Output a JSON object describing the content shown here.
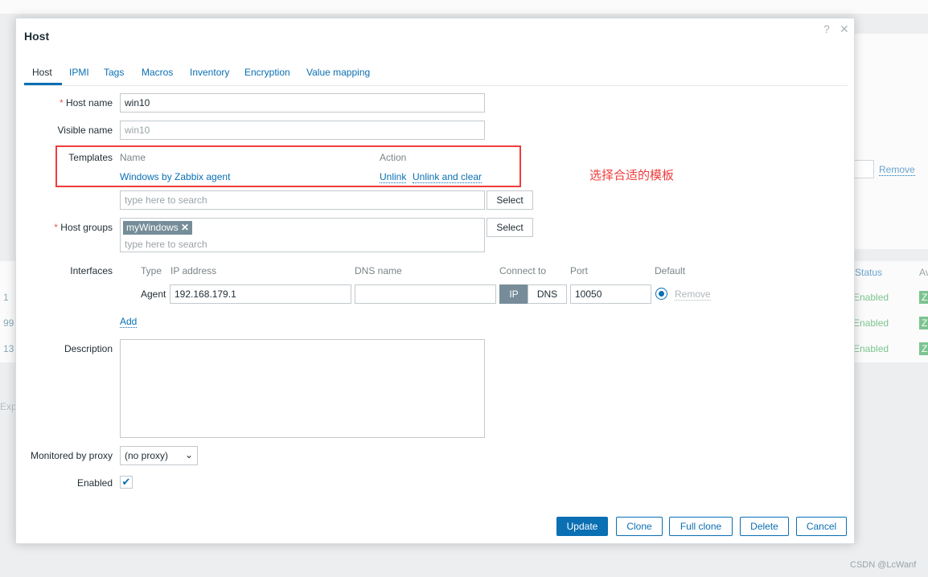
{
  "background": {
    "remove_link": "Remove",
    "status_header": "Status",
    "av_header": "Av",
    "row_ids": [
      "1",
      "99",
      "13"
    ],
    "row_status": [
      "Enabled",
      "Enabled",
      "Enabled"
    ],
    "row_badge": "Z",
    "export_label": "Exp"
  },
  "dialog": {
    "title": "Host",
    "help_icon": "?",
    "close_icon": "✕",
    "tabs": [
      "Host",
      "IPMI",
      "Tags",
      "Macros",
      "Inventory",
      "Encryption",
      "Value mapping"
    ],
    "host_name": {
      "label": "Host name",
      "value": "win10"
    },
    "visible_name": {
      "label": "Visible name",
      "placeholder": "win10"
    },
    "templates": {
      "label": "Templates",
      "col_name": "Name",
      "col_action": "Action",
      "items": [
        {
          "name": "Windows by Zabbix agent",
          "unlink": "Unlink",
          "unlink_clear": "Unlink and clear"
        }
      ],
      "search_placeholder": "type here to search",
      "select": "Select"
    },
    "host_groups": {
      "label": "Host groups",
      "tags": [
        "myWindows"
      ],
      "search_placeholder": "type here to search",
      "select": "Select"
    },
    "interfaces": {
      "label": "Interfaces",
      "cols": [
        "Type",
        "IP address",
        "DNS name",
        "Connect to",
        "Port",
        "Default"
      ],
      "rows": [
        {
          "type": "Agent",
          "ip": "192.168.179.1",
          "dns": "",
          "connect_ip": "IP",
          "connect_dns": "DNS",
          "connect_selected": "IP",
          "port": "10050",
          "default": true,
          "remove": "Remove"
        }
      ],
      "add": "Add"
    },
    "description": {
      "label": "Description",
      "value": ""
    },
    "proxy": {
      "label": "Monitored by proxy",
      "value": "(no proxy)"
    },
    "enabled": {
      "label": "Enabled",
      "checked": true
    },
    "buttons": {
      "update": "Update",
      "clone": "Clone",
      "full_clone": "Full clone",
      "delete": "Delete",
      "cancel": "Cancel"
    }
  },
  "annotation": "选择合适的模板",
  "watermark": "CSDN @LcWanf",
  "colors": {
    "accent": "#0a6fb3",
    "annotation": "#f03c3c",
    "enabled": "#59db8f"
  }
}
